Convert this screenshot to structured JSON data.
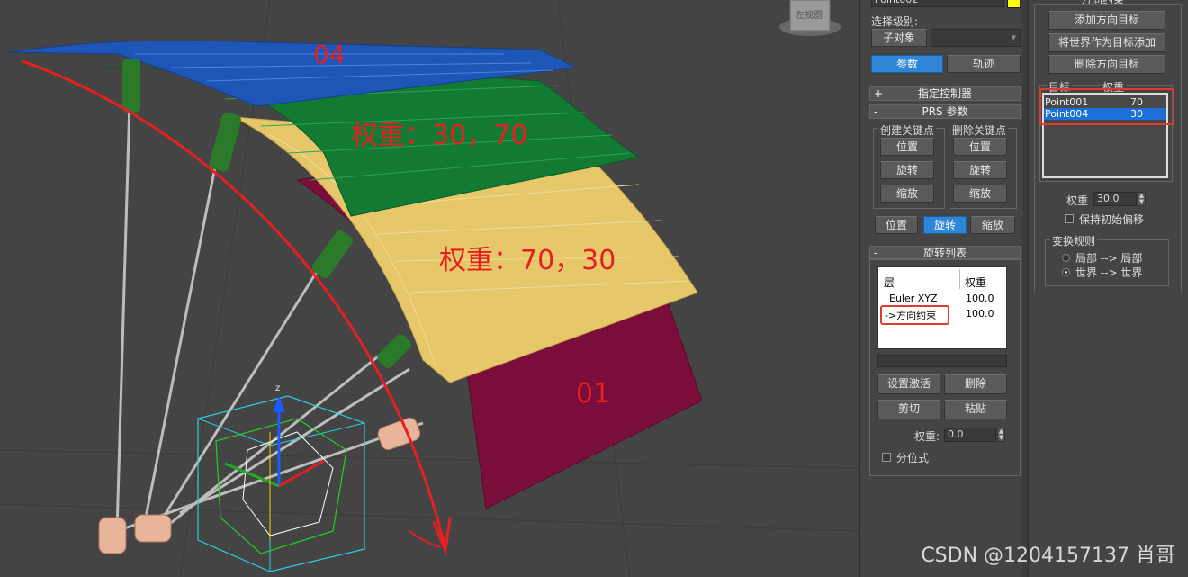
{
  "viewport": {
    "labels": {
      "a": "04",
      "b": "权重：30，70",
      "c": "权重：70，30",
      "d": "01"
    },
    "viewcube_label": "左视图",
    "axis_label": "z",
    "colors": {
      "background": "#444444",
      "blue_panel": "#1e56b8",
      "green_panel": "#127a33",
      "yellow_panel": "#e6c76a",
      "maroon_panel": "#7a0d3a",
      "annotation": "#e62020"
    }
  },
  "watermark": "CSDN @1204157137 肖哥",
  "left_panel": {
    "object_name": "Point002",
    "object_color": "#ffff00",
    "select_level_label": "选择级别:",
    "sub_object_button": "子对象",
    "tabs": {
      "params": "参数",
      "track": "轨迹"
    },
    "assign_controller": {
      "sign": "+",
      "title": "指定控制器"
    },
    "prs": {
      "sign": "-",
      "title": "PRS 参数",
      "create_key_label": "创建关键点",
      "delete_key_label": "删除关键点",
      "create": [
        "位置",
        "旋转",
        "缩放"
      ],
      "delete": [
        "位置",
        "旋转",
        "缩放"
      ],
      "bottom": [
        "位置",
        "旋转",
        "缩放"
      ]
    },
    "rotation_list": {
      "sign": "-",
      "title": "旋转列表",
      "col_layer": "层",
      "col_weight": "权重",
      "rows": [
        {
          "layer": "Euler XYZ",
          "weight": "100.0"
        },
        {
          "layer": "->方向约束",
          "weight": "100.0"
        }
      ],
      "set_active": "设置激活",
      "delete": "删除",
      "cut": "剪切",
      "paste": "粘贴",
      "weight_label": "权重:",
      "weight_value": "0.0",
      "average_label": "分位式"
    }
  },
  "right_panel": {
    "header_partial": "方向约束",
    "add_target": "添加方向目标",
    "add_world": "将世界作为目标添加",
    "delete_target": "删除方向目标",
    "col_target": "目标",
    "col_weight": "权重",
    "targets": [
      {
        "name": "Point001",
        "weight": "70"
      },
      {
        "name": "Point004",
        "weight": "30"
      }
    ],
    "weight_label": "权重",
    "weight_value": "30.0",
    "keep_offset_label": "保持初始偏移",
    "transform_rule_label": "变换规则",
    "rules": [
      "局部 --> 局部",
      "世界 --> 世界"
    ]
  }
}
